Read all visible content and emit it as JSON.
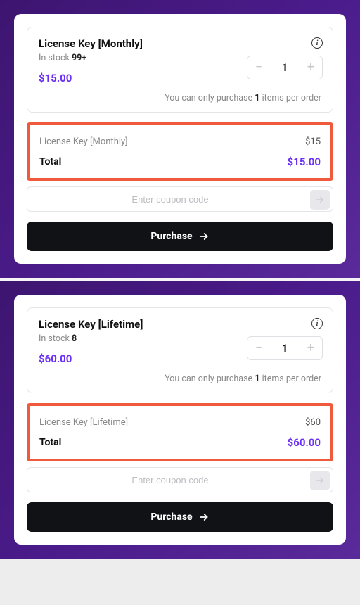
{
  "cards": [
    {
      "product": {
        "title": "License Key [Monthly]",
        "stock_label": "In stock ",
        "stock_count": "99+",
        "price": "$15.00",
        "qty": "1",
        "limit_pre": "You can only purchase ",
        "limit_bold": "1",
        "limit_post": " items per order"
      },
      "summary": {
        "line_name": "License Key [Monthly]",
        "line_price": "$15",
        "total_label": "Total",
        "total_price": "$15.00"
      },
      "coupon_placeholder": "Enter coupon code",
      "purchase_label": "Purchase"
    },
    {
      "product": {
        "title": "License Key [Lifetime]",
        "stock_label": "In stock ",
        "stock_count": "8",
        "price": "$60.00",
        "qty": "1",
        "limit_pre": "You can only purchase ",
        "limit_bold": "1",
        "limit_post": " items per order"
      },
      "summary": {
        "line_name": "License Key [Lifetime]",
        "line_price": "$60",
        "total_label": "Total",
        "total_price": "$60.00"
      },
      "coupon_placeholder": "Enter coupon code",
      "purchase_label": "Purchase"
    }
  ]
}
